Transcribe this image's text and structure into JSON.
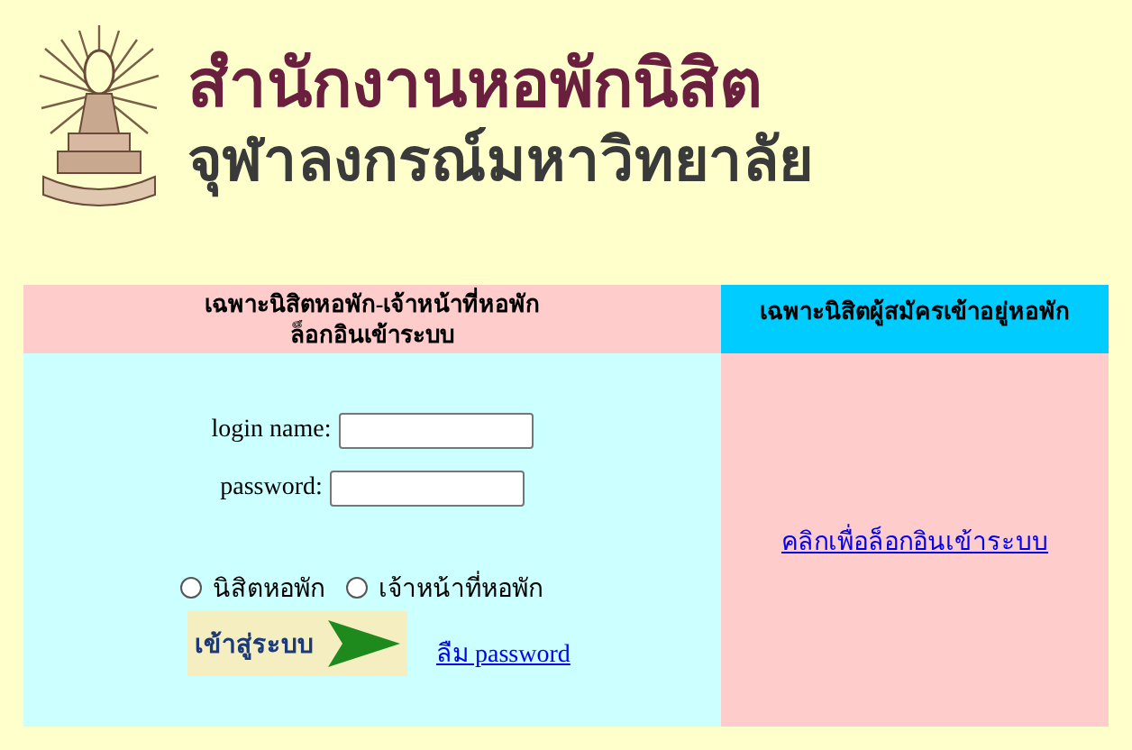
{
  "header": {
    "title": "สำนักงานหอพักนิสิต",
    "subtitle": "จุฬาลงกรณ์มหาวิทยาลัย"
  },
  "left_panel": {
    "heading": [
      "เฉพาะนิสิตหอพัก-เจ้าหน้าที่หอพัก",
      "ล็อกอินเข้าระบบ"
    ],
    "fields": [
      {
        "label": "login name:"
      },
      {
        "label": "password:"
      }
    ],
    "roles": [
      {
        "label": "นิสิตหอพัก",
        "selected": false
      },
      {
        "label": "เจ้าหน้าที่หอพัก",
        "selected": false
      }
    ],
    "login_button": "เข้าสู่ระบบ",
    "forgot_link": "ลืม password"
  },
  "right_panel": {
    "heading": "เฉพาะนิสิตผู้สมัครเข้าอยู่หอพัก",
    "login_link": "คลิกเพื่อล็อกอินเข้าระบบ"
  }
}
